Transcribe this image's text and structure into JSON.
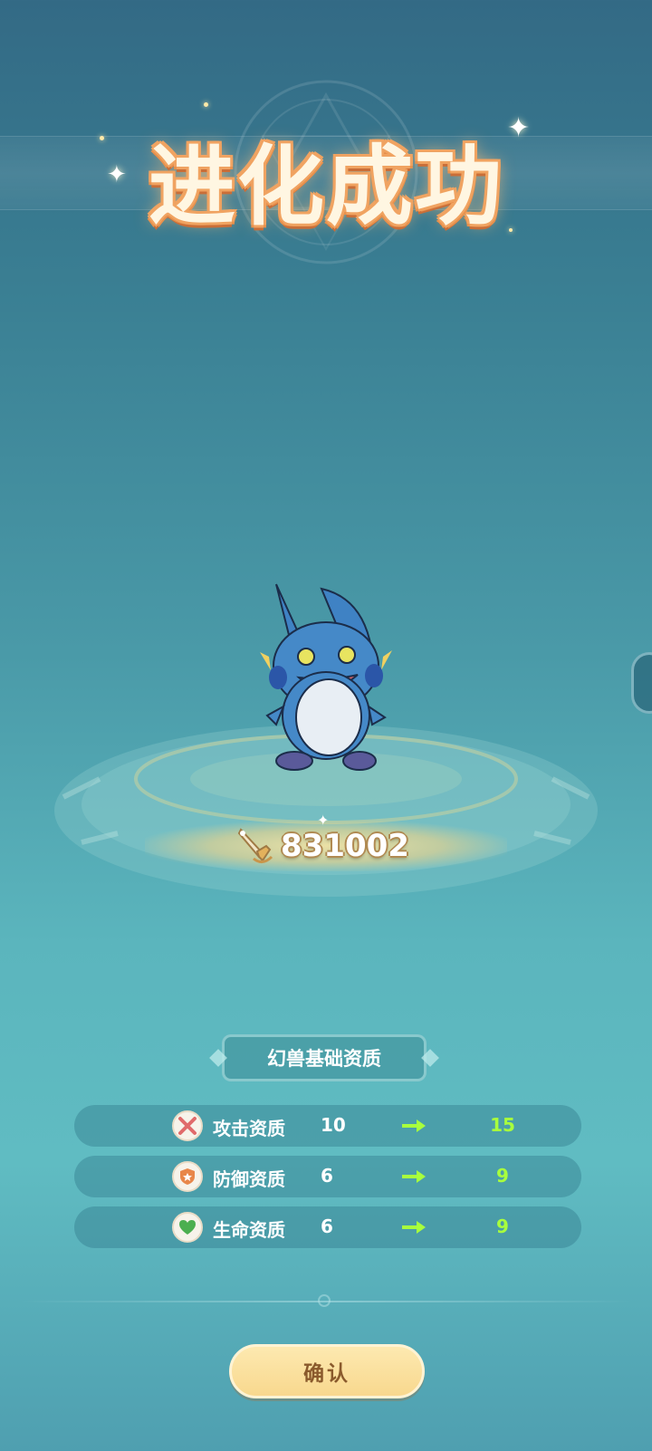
{
  "title": "进化成功",
  "power": {
    "value": "831002",
    "icon": "sword-icon"
  },
  "section": {
    "title": "幻兽基础资质"
  },
  "stats": [
    {
      "label": "攻击资质",
      "from": "10",
      "to": "15",
      "icon": "attack-icon",
      "color": "#e06b6b"
    },
    {
      "label": "防御资质",
      "from": "6",
      "to": "9",
      "icon": "defense-icon",
      "color": "#e8874a"
    },
    {
      "label": "生命资质",
      "from": "6",
      "to": "9",
      "icon": "health-icon",
      "color": "#4caf50"
    }
  ],
  "confirm": {
    "label": "确认"
  },
  "colors": {
    "accent_new_value": "#a8ff3d",
    "button": "#f8d88e",
    "title_outline": "#f0a361"
  }
}
